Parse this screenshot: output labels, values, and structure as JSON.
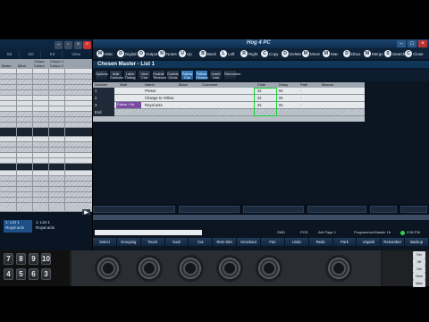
{
  "window": {
    "title": "Hog 4 PC"
  },
  "toolbar": {
    "items": [
      {
        "label": "Misc",
        "icon": "misc-icon"
      },
      {
        "label": "Digital",
        "icon": "digital-icon"
      },
      {
        "label": "Output",
        "icon": "output-icon"
      },
      {
        "label": "Notes",
        "icon": "notes-icon"
      },
      {
        "label": "Up",
        "icon": "up-icon"
      },
      {
        "label": "Back",
        "icon": "back-icon"
      },
      {
        "label": "Left",
        "icon": "left-icon"
      },
      {
        "label": "Right",
        "icon": "right-icon"
      },
      {
        "label": "Copy",
        "icon": "copy-icon"
      },
      {
        "label": "Delete",
        "icon": "delete-icon"
      },
      {
        "label": "Move",
        "icon": "move-icon"
      },
      {
        "label": "Mac",
        "icon": "mac-icon"
      },
      {
        "label": "Dbox",
        "icon": "dbox-icon"
      },
      {
        "label": "Merge",
        "icon": "merge-icon"
      },
      {
        "label": "Search",
        "icon": "search-icon"
      },
      {
        "label": "Close",
        "icon": "close-icon"
      }
    ]
  },
  "left_pane": {
    "tabs": [
      "SE",
      "SD",
      "Kit"
    ],
    "view_label": "View",
    "col_headers": [
      "Beam",
      "Blind",
      "Colour",
      "Colour 1",
      "Colour 2"
    ],
    "list_items": [
      {
        "label": "1: List 1",
        "sub": "Royal acts"
      },
      {
        "label": "1: List 1",
        "sub": "Royal acts"
      }
    ]
  },
  "chosen_master": {
    "title": "Chosen Master - List 1",
    "buttons": [
      {
        "label": "Options",
        "active": false
      },
      {
        "label": "Wait Controls",
        "active": false
      },
      {
        "label": "Latch Timing",
        "active": false
      },
      {
        "label": "View Cue",
        "active": false
      },
      {
        "label": "Enable Timecode",
        "active": false
      },
      {
        "label": "Enable Clock",
        "active": false
      },
      {
        "label": "Follow Cue",
        "active": true
      },
      {
        "label": "Follow Chosen",
        "active": true
      },
      {
        "label": "Insert Link",
        "active": false
      },
      {
        "label": "Renumber",
        "active": false
      }
    ],
    "columns": [
      "Number",
      "Wait",
      "Name",
      "Black",
      "Comment",
      "Fade",
      "Delay",
      "Path",
      "Macros"
    ],
    "rows": [
      {
        "num": "1",
        "wait": "",
        "name": "Preset",
        "fade": "2s",
        "delay": "0s",
        "path": "-"
      },
      {
        "num": "2",
        "wait": "",
        "name": "Change to Yellow",
        "fade": "2s",
        "delay": "0s",
        "path": "-"
      },
      {
        "num": "3",
        "wait": "Follow + 5s",
        "name": "Royal acts",
        "fade": "2s",
        "delay": "0s",
        "path": "-"
      },
      {
        "num": "End",
        "wait": "",
        "name": "",
        "fade": "",
        "delay": "",
        "path": ""
      }
    ]
  },
  "status": {
    "left": "SMD",
    "pos": "POS",
    "page": "Attr Page 1",
    "programmer": "Programmer/Master 1b",
    "time": "2:56 PM"
  },
  "softkeys": [
    "Select",
    "Grouping",
    "Touch",
    "Suck",
    "Cut",
    "Rem Dim",
    "Knockout",
    "Fan",
    "Undo",
    "Redo",
    "Park",
    "Unpark",
    "Renumber",
    "Backup"
  ],
  "keypad": {
    "keys": [
      "7",
      "8",
      "9",
      "10",
      "4",
      "5",
      "6",
      "3"
    ]
  },
  "side_panel": {
    "buttons": [
      "Rel",
      "Off",
      "Set",
      "Next",
      "Main"
    ]
  },
  "colors": {
    "accent": "#1f5c99",
    "fade_selection": "#18d23a",
    "follow_cell": "#7a4aa0"
  }
}
